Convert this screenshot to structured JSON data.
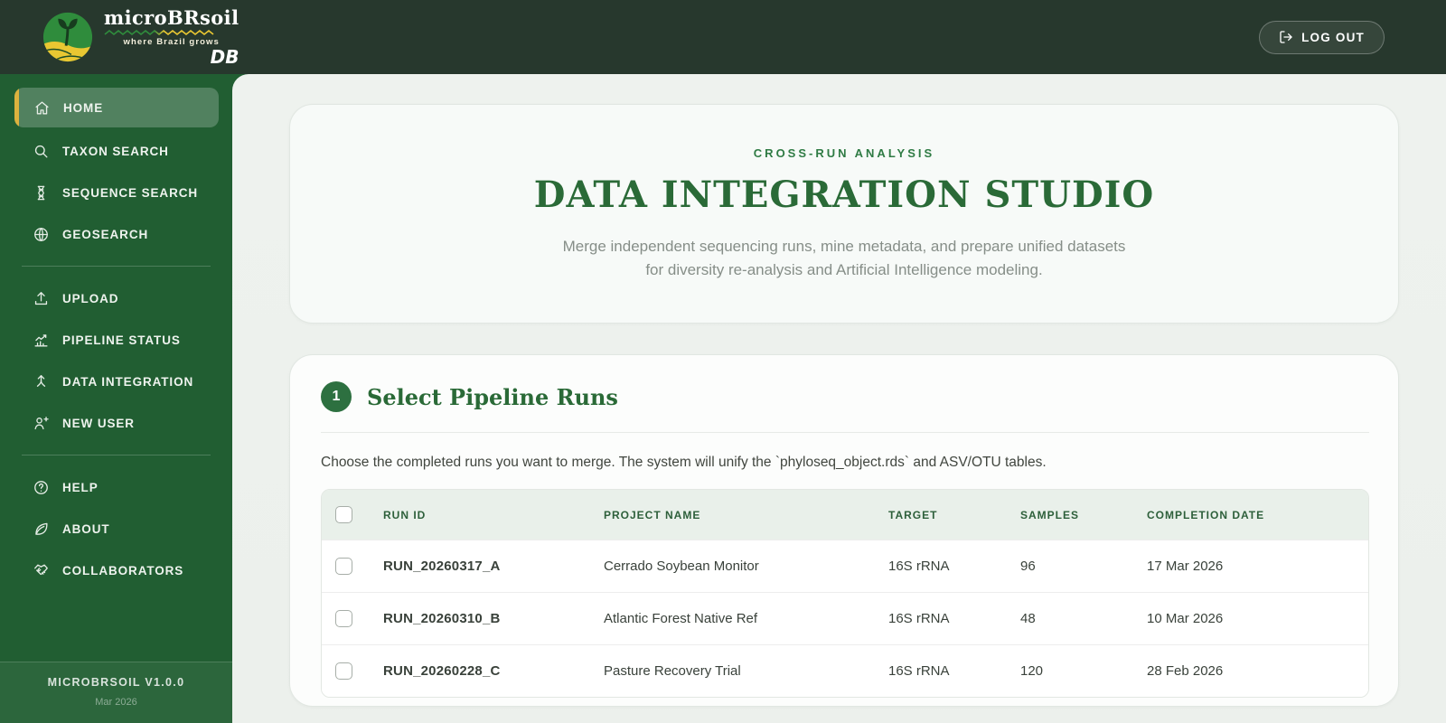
{
  "brand": {
    "name": "microBRsoil",
    "tagline": "where Brazil grows",
    "suffix": "DB",
    "logo_icon": "sprout-field-logo"
  },
  "topbar": {
    "logout_label": "LOG OUT",
    "logout_icon": "logout-icon"
  },
  "sidebar": {
    "groups": [
      {
        "items": [
          {
            "label": "HOME",
            "icon": "home-icon",
            "active": true
          },
          {
            "label": "TAXON SEARCH",
            "icon": "search-icon",
            "active": false
          },
          {
            "label": "SEQUENCE SEARCH",
            "icon": "dna-icon",
            "active": false
          },
          {
            "label": "GEOSEARCH",
            "icon": "globe-icon",
            "active": false
          }
        ]
      },
      {
        "items": [
          {
            "label": "UPLOAD",
            "icon": "upload-icon",
            "active": false
          },
          {
            "label": "PIPELINE STATUS",
            "icon": "chart-icon",
            "active": false
          },
          {
            "label": "DATA INTEGRATION",
            "icon": "merge-icon",
            "active": false
          },
          {
            "label": "NEW USER",
            "icon": "user-plus-icon",
            "active": false
          }
        ]
      },
      {
        "items": [
          {
            "label": "HELP",
            "icon": "help-icon",
            "active": false
          },
          {
            "label": "ABOUT",
            "icon": "leaf-icon",
            "active": false
          },
          {
            "label": "COLLABORATORS",
            "icon": "handshake-icon",
            "active": false
          }
        ]
      }
    ],
    "footer": {
      "version": "MICROBRSOIL V1.0.0",
      "date": "Mar 2026"
    }
  },
  "hero": {
    "eyebrow": "CROSS-RUN ANALYSIS",
    "title": "DATA INTEGRATION STUDIO",
    "subtitle_line1": "Merge independent sequencing runs, mine metadata, and prepare unified datasets",
    "subtitle_line2": "for diversity re-analysis and Artificial Intelligence modeling."
  },
  "step": {
    "number": "1",
    "title": "Select Pipeline Runs",
    "description": "Choose the completed runs you want to merge. The system will unify the `phyloseq_object.rds` and ASV/OTU tables."
  },
  "runs_table": {
    "columns": [
      "RUN ID",
      "PROJECT NAME",
      "TARGET",
      "SAMPLES",
      "COMPLETION DATE"
    ],
    "rows": [
      {
        "run_id": "RUN_20260317_A",
        "project": "Cerrado Soybean Monitor",
        "target": "16S rRNA",
        "samples": "96",
        "date": "17 Mar 2026",
        "checked": false
      },
      {
        "run_id": "RUN_20260310_B",
        "project": "Atlantic Forest Native Ref",
        "target": "16S rRNA",
        "samples": "48",
        "date": "10 Mar 2026",
        "checked": false
      },
      {
        "run_id": "RUN_20260228_C",
        "project": "Pasture Recovery Trial",
        "target": "16S rRNA",
        "samples": "120",
        "date": "28 Feb 2026",
        "checked": false
      }
    ]
  },
  "colors": {
    "topbar": "#27382d",
    "sidebar_green": "#215e32",
    "accent_yellow": "#dcb23e",
    "heading_green": "#2a6a37",
    "step_circle_green": "#2d7040",
    "table_header_bg": "#e9f0ea",
    "page_bg": "#edf1ed"
  }
}
